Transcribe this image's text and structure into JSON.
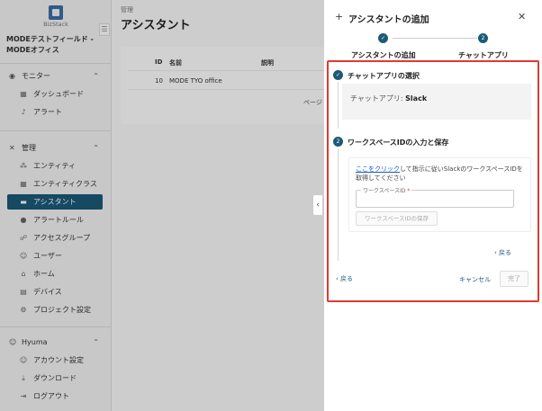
{
  "app": {
    "logo_text": "BizStack",
    "org_name": "MODEテストフィールド - MODEオフィス"
  },
  "sidebar": {
    "sections": [
      {
        "label": "モニター",
        "icon": "eye-icon",
        "items": [
          {
            "label": "ダッシュボード",
            "icon": "grid-icon"
          },
          {
            "label": "アラート",
            "icon": "bell-icon"
          }
        ]
      },
      {
        "label": "管理",
        "icon": "tools-icon",
        "items": [
          {
            "label": "エンティティ",
            "icon": "entity-icon"
          },
          {
            "label": "エンティティクラス",
            "icon": "class-icon"
          },
          {
            "label": "アシスタント",
            "icon": "assistant-icon",
            "active": true
          },
          {
            "label": "アラートルール",
            "icon": "alert-rule-icon"
          },
          {
            "label": "アクセスグループ",
            "icon": "access-group-icon"
          },
          {
            "label": "ユーザー",
            "icon": "user-icon"
          },
          {
            "label": "ホーム",
            "icon": "home-icon"
          },
          {
            "label": "デバイス",
            "icon": "device-icon"
          },
          {
            "label": "プロジェクト設定",
            "icon": "settings-icon"
          }
        ]
      },
      {
        "label": "Hyuma",
        "icon": "account-circle-icon",
        "items": [
          {
            "label": "アカウント設定",
            "icon": "account-settings-icon"
          },
          {
            "label": "ダウンロード",
            "icon": "download-icon"
          },
          {
            "label": "ログアウト",
            "icon": "logout-icon"
          }
        ]
      }
    ]
  },
  "main": {
    "breadcrumb": "管理",
    "title": "アシスタント",
    "table": {
      "headers": [
        "ID",
        "名前",
        "説明"
      ],
      "rows": [
        [
          "10",
          "MODE TYO office",
          ""
        ]
      ],
      "pager_text": "ページ"
    }
  },
  "drawer": {
    "title": "アシスタントの追加",
    "steps": [
      {
        "label": "アシスタントの追加",
        "state": "done"
      },
      {
        "label": "チャットアプリ",
        "number": "2",
        "state": "current"
      }
    ],
    "section1": {
      "title": "チャットアプリの選択",
      "chat_app_label": "チャットアプリ: ",
      "chat_app_value": "Slack"
    },
    "section2": {
      "number": "2",
      "title": "ワークスペースIDの入力と保存",
      "link_text": "ここをクリック",
      "instruction_rest": "して指示に従いSlackのワークスペースIDを取得してください",
      "field_label": "ワークスペースID",
      "field_required": "*",
      "field_value": "",
      "save_button": "ワークスペースIDの保存",
      "back_label": "戻る"
    },
    "footer": {
      "back_label": "戻る",
      "cancel_label": "キャンセル",
      "done_label": "完了"
    }
  }
}
